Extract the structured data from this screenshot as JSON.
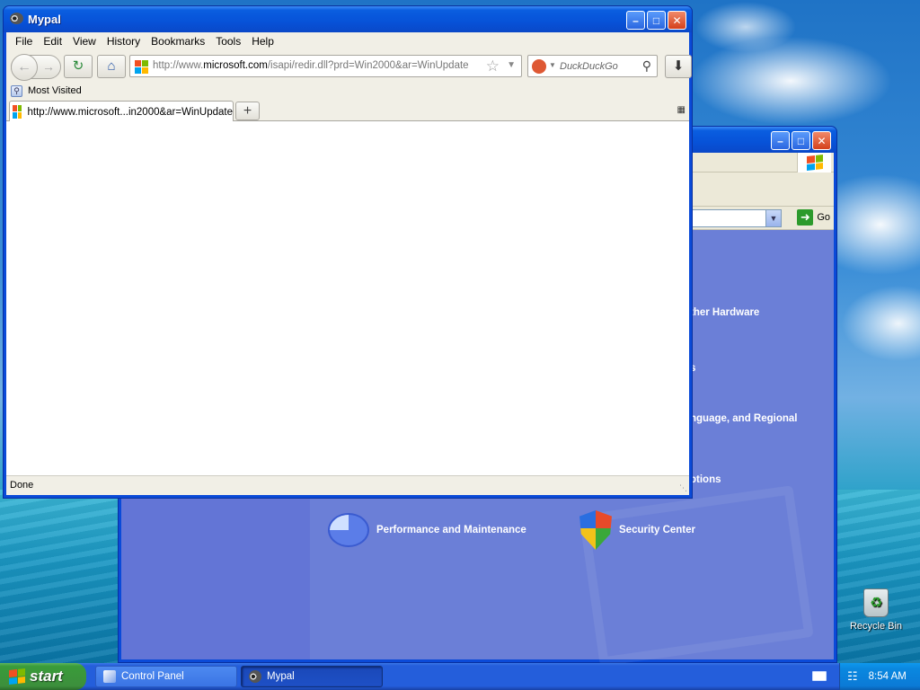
{
  "desktop": {
    "recycle_bin_label": "Recycle Bin"
  },
  "control_panel": {
    "address_go": "Go",
    "categories_partial": [
      "ther Hardware",
      "s",
      "nguage, and Regional",
      "ptions"
    ],
    "items": [
      {
        "label": "Performance and Maintenance",
        "icon": "performance-icon"
      },
      {
        "label": "Security Center",
        "icon": "security-shield-icon"
      }
    ]
  },
  "mypal": {
    "title": "Mypal",
    "menu": [
      "File",
      "Edit",
      "View",
      "History",
      "Bookmarks",
      "Tools",
      "Help"
    ],
    "url_prefix": "http://www.",
    "url_host": "microsoft.com",
    "url_rest": "/isapi/redir.dll?prd=Win2000&ar=WinUpdate",
    "search_placeholder": "DuckDuckGo",
    "bookmarks_toolbar": {
      "most_visited": "Most Visited"
    },
    "tabs": [
      {
        "title": "http://www.microsoft...in2000&ar=WinUpdate",
        "active": true
      }
    ],
    "new_tab_label": "+",
    "status": "Done"
  },
  "taskbar": {
    "start_label": "start",
    "tasks": [
      {
        "label": "Control Panel",
        "active": false
      },
      {
        "label": "Mypal",
        "active": true
      }
    ],
    "clock": "8:54 AM"
  },
  "colors": {
    "xp_blue": "#0a4ad8",
    "cp_content": "#6b7fd7",
    "start_green": "#3a9c3a"
  }
}
